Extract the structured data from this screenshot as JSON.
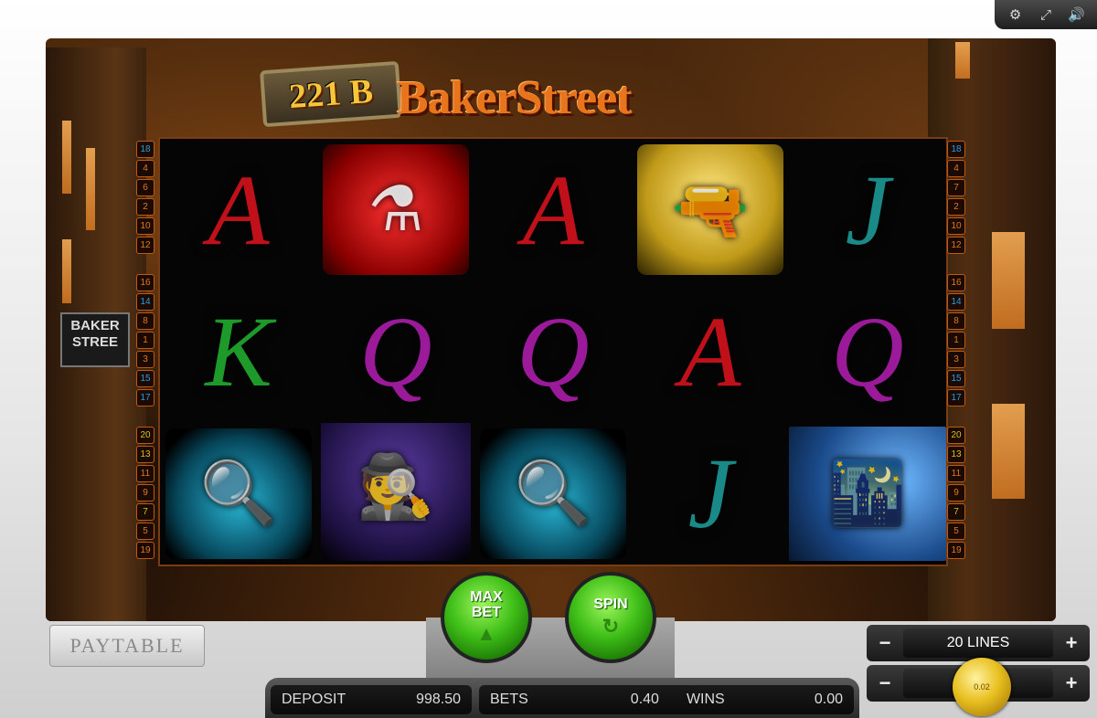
{
  "topbar": {
    "icons": [
      "gear-icon",
      "fullscreen-icon",
      "sound-icon"
    ],
    "glyphs": [
      "⚙",
      "⤢",
      "🔊"
    ]
  },
  "game": {
    "logo_plate": "221 B",
    "logo_title": "BakerStreet",
    "street_sign": "BAKER STREE",
    "paylines_left": [
      "18",
      "4",
      "6",
      "2",
      "10",
      "12",
      "16",
      "14",
      "8",
      "1",
      "3",
      "15",
      "17",
      "20",
      "13",
      "11",
      "9",
      "7",
      "5",
      "19"
    ],
    "paylines_right": [
      "18",
      "4",
      "7",
      "2",
      "10",
      "12",
      "16",
      "14",
      "8",
      "1",
      "3",
      "15",
      "17",
      "20",
      "13",
      "11",
      "9",
      "7",
      "5",
      "19"
    ],
    "reels": [
      [
        {
          "sym": "A"
        },
        {
          "sym": "K"
        },
        {
          "sym": "magnifier"
        }
      ],
      [
        {
          "sym": "poison"
        },
        {
          "sym": "Q"
        },
        {
          "sym": "detective"
        }
      ],
      [
        {
          "sym": "A"
        },
        {
          "sym": "Q"
        },
        {
          "sym": "magnifier"
        }
      ],
      [
        {
          "sym": "gun"
        },
        {
          "sym": "A"
        },
        {
          "sym": "J"
        }
      ],
      [
        {
          "sym": "J"
        },
        {
          "sym": "Q"
        },
        {
          "sym": "night-street"
        }
      ]
    ]
  },
  "controls": {
    "paytable_label": "PAYTABLE",
    "maxbet_label": "MAX BET",
    "spin_label": "SPIN",
    "lines": {
      "minus": "−",
      "plus": "+",
      "value": "20 LINES"
    },
    "bet_stepper": {
      "minus": "−",
      "plus": "+"
    },
    "coin_value": "0.02"
  },
  "status": {
    "deposit_label": "DEPOSIT",
    "deposit_value": "998.50",
    "bets_label": "BETS",
    "bets_value": "0.40",
    "wins_label": "WINS",
    "wins_value": "0.00"
  },
  "colors": {
    "accent_green": "#3fbe18",
    "frame_orange": "#c05a10",
    "coin_gold": "#e8c020"
  }
}
